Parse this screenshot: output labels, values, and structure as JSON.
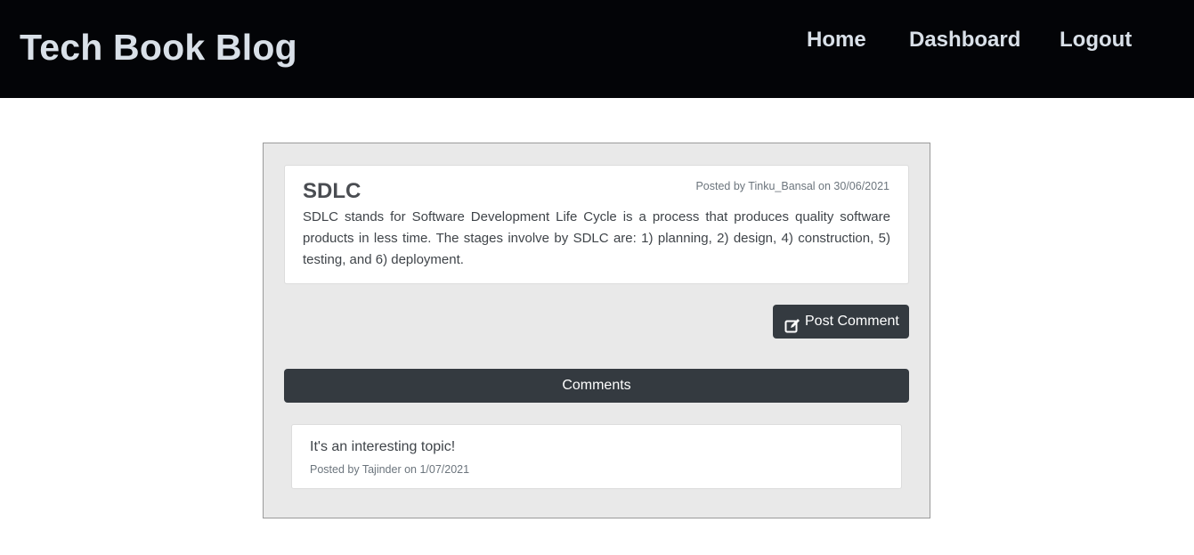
{
  "navbar": {
    "brand": "Tech Book Blog",
    "links": {
      "home": "Home",
      "dashboard": "Dashboard",
      "logout": "Logout"
    },
    "background": "#030407",
    "text_color": "#d9e0e8"
  },
  "post": {
    "title": "SDLC",
    "meta": "Posted by Tinku_Bansal on 30/06/2021",
    "body": "SDLC stands for Software Development Life Cycle is a process that produces quality software products in less time. The stages involve by SDLC are: 1) planning, 2) design, 4) construction, 5) testing, and 6) deployment."
  },
  "actions": {
    "post_comment_label": "Post Comment",
    "post_comment_icon": "edit-icon"
  },
  "comments": {
    "header": "Comments",
    "items": [
      {
        "text": "It's an interesting topic!",
        "meta": "Posted by Tajinder on 1/07/2021"
      }
    ]
  },
  "colors": {
    "dark_button": "#343a40",
    "panel_background": "#e9e9e9",
    "muted_text": "#6c757d"
  }
}
